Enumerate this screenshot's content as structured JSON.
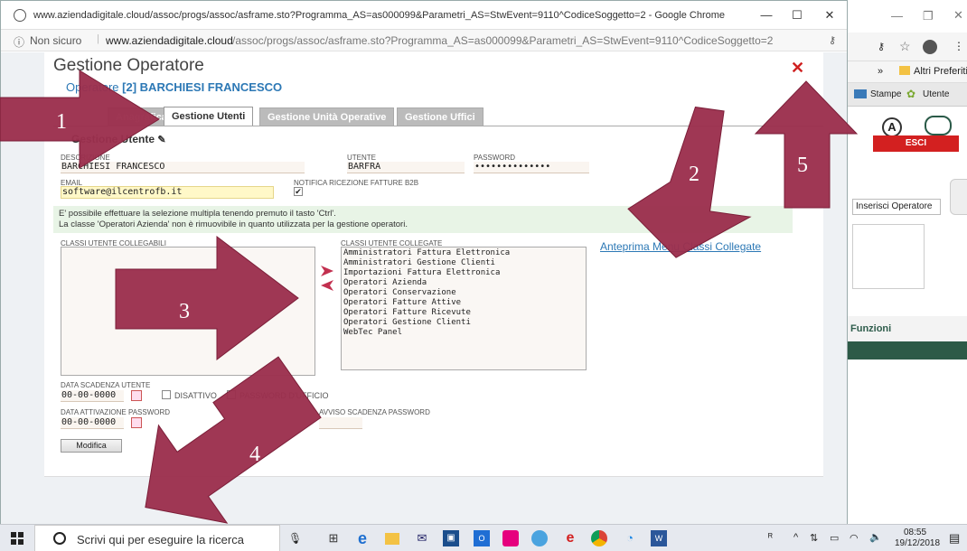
{
  "popup": {
    "title": "www.aziendadigitale.cloud/assoc/progs/assoc/asframe.sto?Programma_AS=as000099&Parametri_AS=StwEvent=9110^CodiceSoggetto=2 - Google Chrome",
    "url_prefix": "Non sicuro",
    "url_domain": "www.aziendadigitale.cloud",
    "url_path": "/assoc/progs/assoc/asframe.sto?Programma_AS=as000099&Parametri_AS=StwEvent=9110^CodiceSoggetto=2"
  },
  "page": {
    "title": "Gestione Operatore",
    "operatore_label": "Operatore",
    "operatore_value": "[2] BARCHIESI FRANCESCO",
    "tabs": [
      "Anagrafica",
      "Gestione Utenti",
      "Gestione Unità Operative",
      "Gestione Uffici"
    ],
    "section_title": "Gestione Utente"
  },
  "form": {
    "descrizione_label": "DESCRIZIONE",
    "descrizione_value": "BARCHIESI FRANCESCO",
    "utente_label": "UTENTE",
    "utente_value": "BARFRA",
    "password_label": "PASSWORD",
    "password_value": "••••••••••••••",
    "email_label": "EMAIL",
    "email_value": "software@ilcentrofb.it",
    "notifica_label": "NOTIFICA RICEZIONE FATTURE B2B",
    "info_line1": "E' possibile effettuare la selezione multipla tenendo premuto il tasto 'Ctrl'.",
    "info_line2": "La classe 'Operatori Azienda' non è rimuovibile in quanto utilizzata per la gestione operatori.",
    "classi_collegabili_label": "CLASSI UTENTE COLLEGABILI",
    "classi_collegate_label": "CLASSI UTENTE COLLEGATE",
    "classi_collegate": [
      "Amministratori Fattura Elettronica",
      "Amministratori Gestione Clienti",
      "Importazioni Fattura Elettronica",
      "Operatori Azienda",
      "Operatori Conservazione",
      "Operatori Fatture Attive",
      "Operatori Fatture Ricevute",
      "Operatori Gestione Clienti",
      "WebTec Panel"
    ],
    "anteprima_link": "Anteprima Menu Classi Collegate",
    "data_scadenza_label": "DATA SCADENZA UTENTE",
    "data_scadenza_value": "00-00-0000",
    "disattivo_label": "DISATTIVO",
    "password_ufficio_label": "PASSWORD D'UFFICIO",
    "data_attivazione_label": "DATA ATTIVAZIONE PASSWORD",
    "data_attivazione_value": "00-00-0000",
    "avviso_label": "AVVISO SCADENZA PASSWORD",
    "modifica_button": "Modifica"
  },
  "background_browser": {
    "bookmark": "Altri Preferiti",
    "stampe": "Stampe",
    "utente": "Utente",
    "esci": "ESCI",
    "inserisci": "Inserisci Operatore",
    "funzioni": "Funzioni"
  },
  "annotations": [
    "1",
    "2",
    "3",
    "4",
    "5"
  ],
  "taskbar": {
    "search_placeholder": "Scrivi qui per eseguire la ricerca",
    "time": "08:55",
    "date": "19/12/2018"
  },
  "colors": {
    "arrow": "#9b2f4d",
    "tab_active_text": "#333333",
    "link": "#2c78b5",
    "esci": "#d32020"
  }
}
